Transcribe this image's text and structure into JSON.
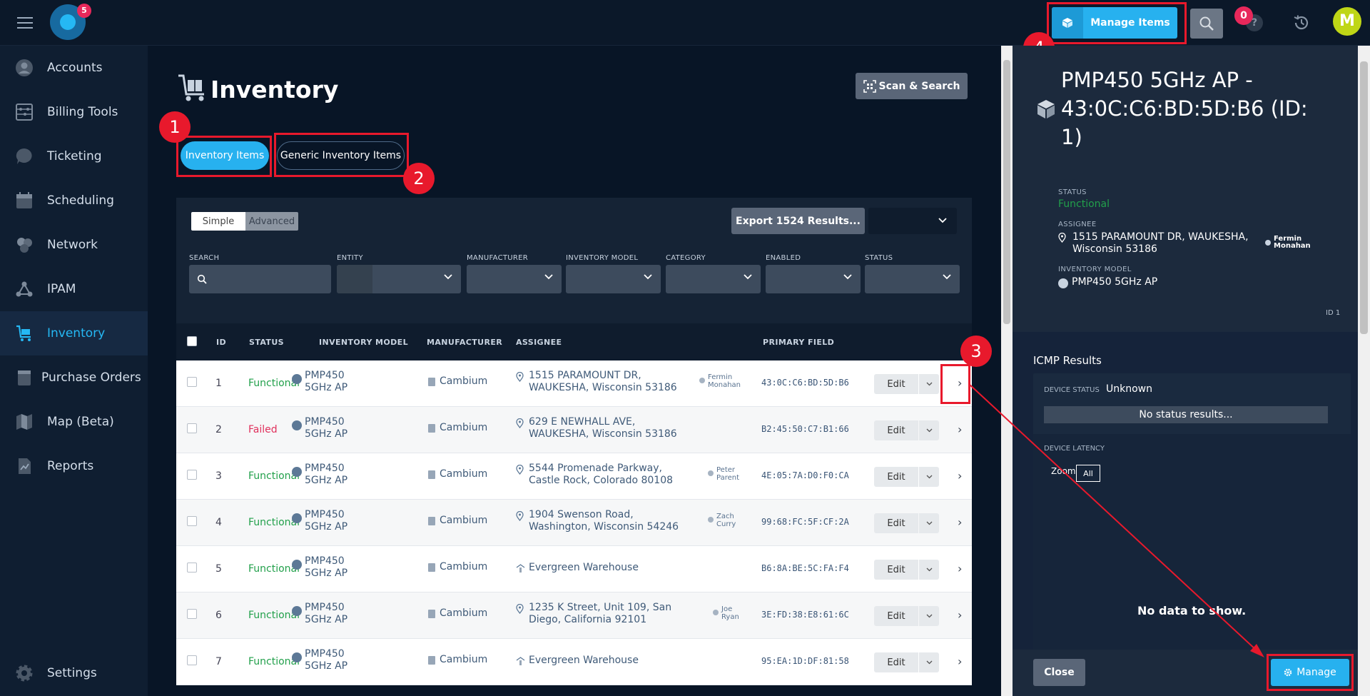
{
  "header": {
    "logo_badge": "5",
    "manage_items_label": "Manage Items",
    "notifications_badge": "0",
    "help_glyph": "?",
    "avatar_initial": "M"
  },
  "annotations": [
    "1",
    "2",
    "3",
    "4"
  ],
  "sidebar": {
    "items": [
      {
        "label": "Accounts",
        "icon": "person-icon"
      },
      {
        "label": "Billing Tools",
        "icon": "abacus-icon"
      },
      {
        "label": "Ticketing",
        "icon": "chat-bubble-icon"
      },
      {
        "label": "Scheduling",
        "icon": "calendar-icon"
      },
      {
        "label": "Network",
        "icon": "hexagons-icon"
      },
      {
        "label": "IPAM",
        "icon": "network-nodes-icon"
      },
      {
        "label": "Inventory",
        "icon": "cart-icon",
        "active": true
      },
      {
        "label": "Purchase Orders",
        "icon": "notepad-icon"
      },
      {
        "label": "Map (Beta)",
        "icon": "map-icon"
      },
      {
        "label": "Reports",
        "icon": "report-icon"
      }
    ],
    "settings_label": "Settings"
  },
  "main": {
    "title": "Inventory",
    "scan_search_label": "Scan & Search",
    "tabs": [
      "Inventory Items",
      "Generic Inventory Items"
    ],
    "mode_simple": "Simple",
    "mode_advanced": "Advanced",
    "export_label": "Export 1524 Results...",
    "filters": [
      "SEARCH",
      "ENTITY",
      "MANUFACTURER",
      "INVENTORY MODEL",
      "CATEGORY",
      "ENABLED",
      "STATUS"
    ],
    "columns": [
      "ID",
      "STATUS",
      "INVENTORY MODEL",
      "MANUFACTURER",
      "ASSIGNEE",
      "PRIMARY FIELD"
    ],
    "edit_label": "Edit",
    "rows": [
      {
        "id": "1",
        "status": "Functional",
        "model": "PMP450 5GHz AP",
        "manufacturer": "Cambium",
        "address": "1515 PARAMOUNT DR, WAUKESHA, Wisconsin 53186",
        "person": "Fermin Monahan",
        "mac": "43:0C:C6:BD:5D:B6"
      },
      {
        "id": "2",
        "status": "Failed",
        "model": "PMP450 5GHz AP",
        "manufacturer": "Cambium",
        "address": "629 E NEWHALL AVE, WAUKESHA, Wisconsin 53186",
        "person": "",
        "mac": "B2:45:50:C7:B1:66"
      },
      {
        "id": "3",
        "status": "Functional",
        "model": "PMP450 5GHz AP",
        "manufacturer": "Cambium",
        "address": "5544 Promenade Parkway, Castle Rock, Colorado 80108",
        "person": "Peter Parent",
        "mac": "4E:05:7A:D0:F0:CA"
      },
      {
        "id": "4",
        "status": "Functional",
        "model": "PMP450 5GHz AP",
        "manufacturer": "Cambium",
        "address": "1904 Swenson Road, Washington, Wisconsin 54246",
        "person": "Zach Curry",
        "mac": "99:68:FC:5F:CF:2A"
      },
      {
        "id": "5",
        "status": "Functional",
        "model": "PMP450 5GHz AP",
        "manufacturer": "Cambium",
        "address": "Evergreen Warehouse",
        "person": "",
        "mac": "B6:8A:BE:5C:FA:F4"
      },
      {
        "id": "6",
        "status": "Functional",
        "model": "PMP450 5GHz AP",
        "manufacturer": "Cambium",
        "address": "1235 K Street, Unit 109, San Diego, California 92101",
        "person": "Joe Ryan",
        "mac": "3E:FD:38:E8:61:6C"
      },
      {
        "id": "7",
        "status": "Functional",
        "model": "PMP450 5GHz AP",
        "manufacturer": "Cambium",
        "address": "Evergreen Warehouse",
        "person": "",
        "mac": "95:EA:1D:DF:81:58"
      }
    ]
  },
  "panel": {
    "title": "PMP450 5GHz AP - 43:0C:C6:BD:5D:B6 (ID: 1)",
    "status_label": "STATUS",
    "status_value": "Functional",
    "assignee_label": "ASSIGNEE",
    "assignee_address": "1515 PARAMOUNT DR, WAUKESHA, Wisconsin 53186",
    "assignee_person": "Fermin Monahan",
    "model_label": "INVENTORY MODEL",
    "model_value": "PMP450 5GHz AP",
    "id_tag": "ID 1",
    "icmp_title": "ICMP Results",
    "device_status_label": "DEVICE STATUS",
    "device_status_value": "Unknown",
    "no_status": "No status results...",
    "latency_label": "DEVICE LATENCY",
    "zoom_label": "Zoom",
    "zoom_all": "All",
    "no_data": "No data to show.",
    "close_label": "Close",
    "manage_label": "Manage"
  },
  "colors": {
    "accent": "#27b1ef",
    "functional": "#22a04b",
    "failed": "#e0305c",
    "annotation": "#e8192c"
  }
}
